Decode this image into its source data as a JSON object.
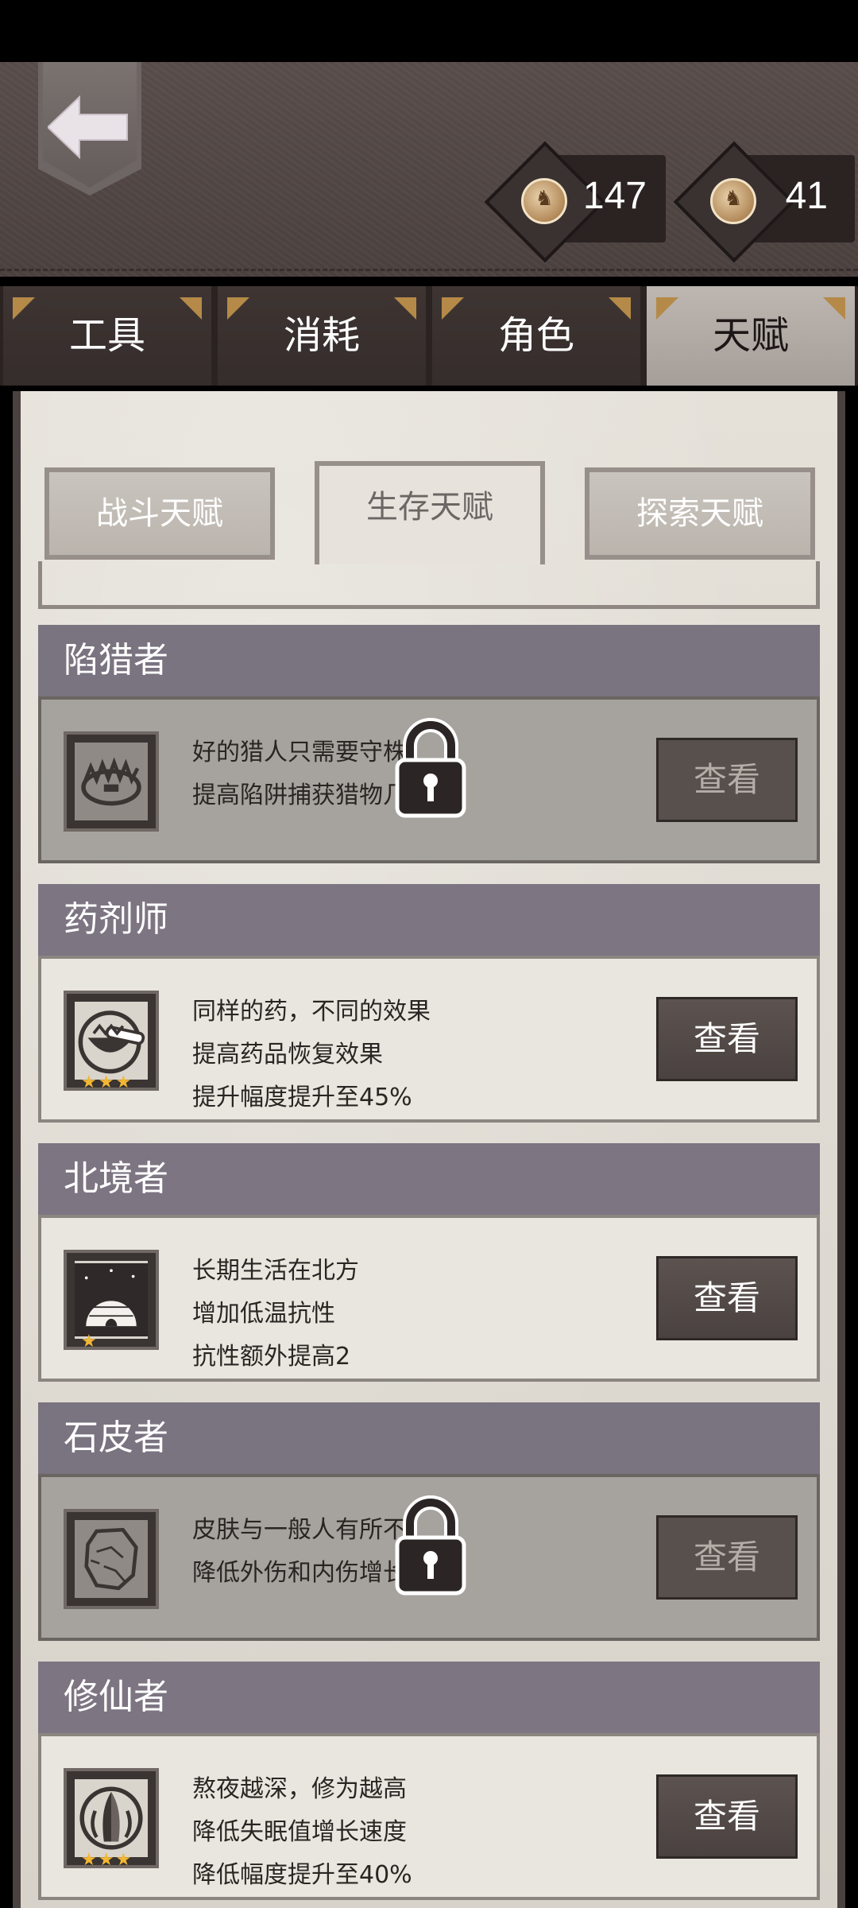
{
  "currencies": [
    {
      "icon": "silver-coin-icon",
      "amount": "147"
    },
    {
      "icon": "bronze-coin-icon",
      "amount": "41"
    }
  ],
  "main_tabs": [
    {
      "label": "工具",
      "active": false
    },
    {
      "label": "消耗",
      "active": false
    },
    {
      "label": "角色",
      "active": false
    },
    {
      "label": "天赋",
      "active": true
    }
  ],
  "sub_tabs": [
    {
      "label": "战斗天赋",
      "active": false
    },
    {
      "label": "生存天赋",
      "active": true
    },
    {
      "label": "探索天赋",
      "active": false
    }
  ],
  "talents": [
    {
      "name": "陷猎者",
      "locked": true,
      "icon": "bear-trap-icon",
      "stars": "",
      "lines": [
        "好的猎人只需要守株",
        "提高陷阱捕获猎物几"
      ],
      "button": "查看"
    },
    {
      "name": "药剂师",
      "locked": false,
      "icon": "mortar-pestle-icon",
      "stars": "★★★",
      "lines": [
        "同样的药，不同的效果",
        "提高药品恢复效果",
        "提升幅度提升至45%"
      ],
      "button": "查看"
    },
    {
      "name": "北境者",
      "locked": false,
      "icon": "igloo-icon",
      "stars": "★",
      "lines": [
        "长期生活在北方",
        "增加低温抗性",
        "抗性额外提高2"
      ],
      "button": "查看"
    },
    {
      "name": "石皮者",
      "locked": true,
      "icon": "stone-skin-icon",
      "stars": "",
      "lines": [
        "皮肤与一般人有所不",
        "降低外伤和内伤增长"
      ],
      "button": "查看"
    },
    {
      "name": "修仙者",
      "locked": false,
      "icon": "meditation-hands-icon",
      "stars": "★★★",
      "lines": [
        "熬夜越深，修为越高",
        "降低失眠值增长速度",
        "降低幅度提升至40%"
      ],
      "button": "查看"
    }
  ]
}
